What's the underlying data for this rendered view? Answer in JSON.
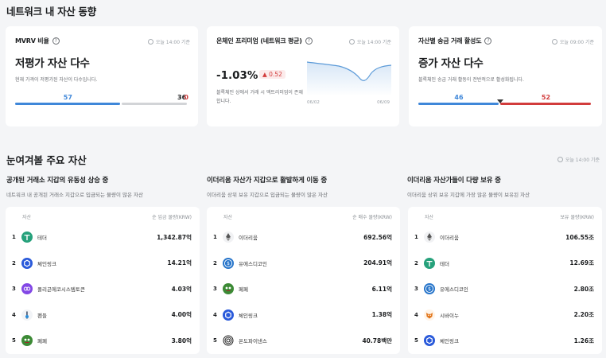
{
  "header": {
    "title": "네트워크 내 자산 동향"
  },
  "cards": {
    "mvrv": {
      "title": "MVRV 비율",
      "time": "오늘 14:00 기준",
      "headline": "저평가 자산 다수",
      "desc": "현재 가격이 저평가된 자산이 다수입니다.",
      "values": {
        "low": "57",
        "mid": "36",
        "high": "0"
      },
      "counts": [
        57,
        36,
        0
      ]
    },
    "premium": {
      "title": "온체인 프리미엄 (네트워크 평균)",
      "time": "오늘 14:00 기준",
      "value": "-1.03%",
      "change": "▲ 0.52",
      "desc": "블록체인 상에서 거래 시 액트리미엄이 존재합니다.",
      "date_start": "06/02",
      "date_end": "06/09"
    },
    "activity": {
      "title": "자산별 송금 거래 활성도",
      "time": "오늘 09:00 기준",
      "headline": "증가 자산 다수",
      "desc": "블록체인 송금 거래 활동이 전반적으로 활성화됩니다.",
      "values": {
        "low": "46",
        "high": "52"
      },
      "counts": [
        46,
        52
      ]
    }
  },
  "section": {
    "title": "눈여겨볼 주요 자산",
    "time": "오늘 14:00 기준"
  },
  "lists": [
    {
      "title": "공개된 거래소 지갑의 유동성 상승 중",
      "desc": "네트워크 내 공개된 거래소 지갑으로 입금되는 물량이 많은 자산",
      "col_asset": "자산",
      "col_value": "순 입금 물량(KRW)",
      "rows": [
        {
          "rank": "1",
          "name": "테더",
          "value": "1,342.87억",
          "icon": "tether-icon"
        },
        {
          "rank": "2",
          "name": "체인링크",
          "value": "14.21억",
          "icon": "chainlink-icon"
        },
        {
          "rank": "3",
          "name": "폴리곤에코시스템토큰",
          "value": "4.03억",
          "icon": "polygon-icon"
        },
        {
          "rank": "4",
          "name": "펜들",
          "value": "4.00억",
          "icon": "pendle-icon"
        },
        {
          "rank": "5",
          "name": "페페",
          "value": "3.80억",
          "icon": "pepe-icon"
        }
      ]
    },
    {
      "title": "이더리움 자산가 지갑으로 활발하게 이동 중",
      "desc": "이더리움 상위 보유 지갑으로 입금되는 물량이 많은 자산",
      "col_asset": "자산",
      "col_value": "순 매수 물량(KRW)",
      "rows": [
        {
          "rank": "1",
          "name": "이더리움",
          "value": "692.56억",
          "icon": "ethereum-icon"
        },
        {
          "rank": "2",
          "name": "유에스디코인",
          "value": "204.91억",
          "icon": "usdc-icon"
        },
        {
          "rank": "3",
          "name": "페페",
          "value": "6.11억",
          "icon": "pepe-icon"
        },
        {
          "rank": "4",
          "name": "체인링크",
          "value": "1.38억",
          "icon": "chainlink-icon"
        },
        {
          "rank": "5",
          "name": "온도파이낸스",
          "value": "40.78백만",
          "icon": "ondo-icon"
        }
      ]
    },
    {
      "title": "이더리움 자산가들이 다량 보유 중",
      "desc": "이더리움 상위 보유 지갑에 가장 많은 물량이 보유된 자산",
      "col_asset": "자산",
      "col_value": "보유 물량(KRW)",
      "rows": [
        {
          "rank": "1",
          "name": "이더리움",
          "value": "106.55조",
          "icon": "ethereum-icon"
        },
        {
          "rank": "2",
          "name": "테더",
          "value": "12.69조",
          "icon": "tether-icon"
        },
        {
          "rank": "3",
          "name": "유에스디코인",
          "value": "2.80조",
          "icon": "usdc-icon"
        },
        {
          "rank": "4",
          "name": "시바이누",
          "value": "2.20조",
          "icon": "shiba-icon"
        },
        {
          "rank": "5",
          "name": "체인링크",
          "value": "1.26조",
          "icon": "chainlink-icon"
        }
      ]
    }
  ]
}
